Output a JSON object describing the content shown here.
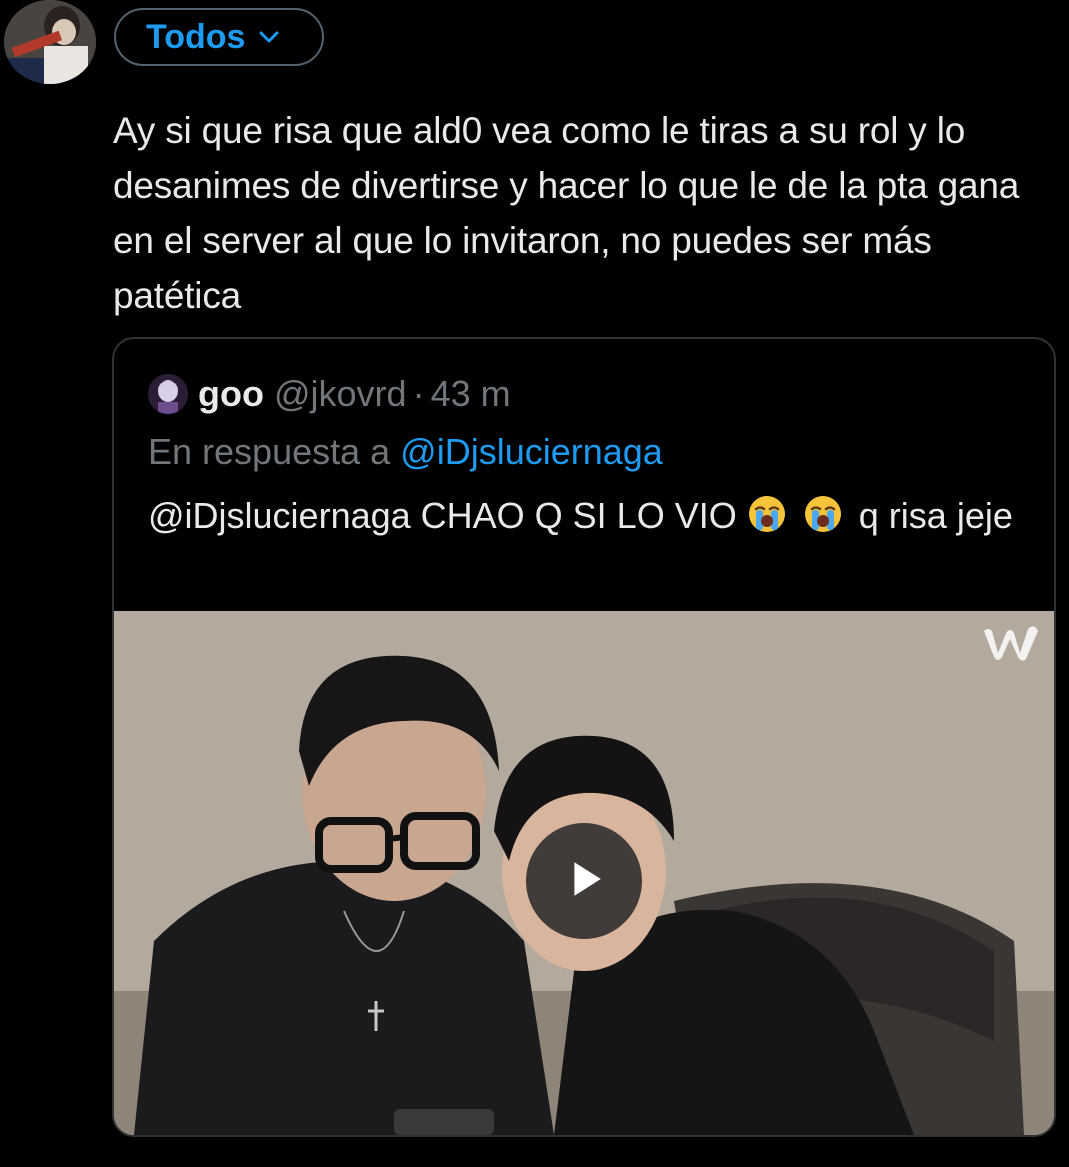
{
  "header": {
    "audience_label": "Todos"
  },
  "tweet": {
    "text": "Ay si que risa que ald0 vea como le tiras a su rol y lo desanimes de divertirse y hacer lo que le de la pta gana en el server al que lo invitaron, no puedes ser más patética"
  },
  "quote": {
    "name": "goo",
    "handle": "@jkovrd",
    "separator": "·",
    "time": "43 m",
    "reply_prefix": "En respuesta a",
    "reply_mention": "@iDjsluciernaga",
    "text_before_emoji": "@iDjsluciernaga CHAO Q SI LO VIO",
    "emoji_1": "loudly-crying-face",
    "emoji_2": "loudly-crying-face",
    "text_after_emoji": "q risa jeje"
  },
  "media": {
    "type": "video",
    "watermark_icon": "weverse-w-icon",
    "play_icon": "play-icon"
  },
  "colors": {
    "background": "#000000",
    "text": "#e7e9ea",
    "muted": "#71767b",
    "accent": "#1d9bf0",
    "border": "#2f3336"
  }
}
